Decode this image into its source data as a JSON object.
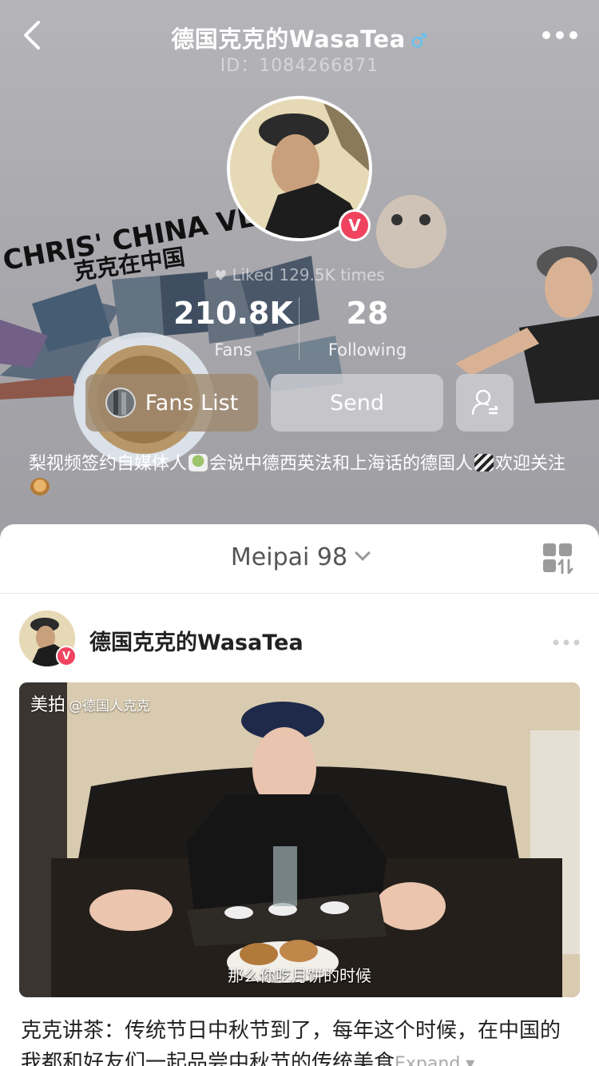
{
  "nav": {
    "title": "德国克克的WasaTea",
    "gender_icon": "♂",
    "id_line": "ID：1084266871"
  },
  "profile": {
    "liked_text": "Liked 129.5K times",
    "fans_count": "210.8K",
    "fans_label": "Fans",
    "following_count": "28",
    "following_label": "Following",
    "verify_mark": "V",
    "cover_text": "CHRIS' CHINA VLOG",
    "cover_subtext": "克克在中国"
  },
  "actions": {
    "fans_list_label": "Fans List",
    "send_label": "Send"
  },
  "bio": {
    "part1": "梨视频签约自媒体人",
    "part2": "会说中德西英法和上海话的德国人",
    "part3": "欢迎关注"
  },
  "tabs": {
    "meipai_label": "Meipai 98"
  },
  "post": {
    "author": "德国克克的WasaTea",
    "watermark": "美拍",
    "watermark_handle": "@德国人克克",
    "subtitle": "那么你吃月饼的时候",
    "caption": "克克讲茶：传统节日中秋节到了，每年这个时候，在中国的我都和好友们一起品尝中秋节的传统美食",
    "expand_label": "Expand ▾"
  },
  "colors": {
    "header_bg": "#a8a8ad",
    "verify_red": "#f0435f",
    "gender_blue": "#5bc3f6"
  },
  "icons": [
    "back-arrow-icon",
    "more-dots-icon",
    "verified-badge-icon",
    "heart-icon",
    "add-friend-icon",
    "chevron-down-icon",
    "grid-sort-icon"
  ]
}
